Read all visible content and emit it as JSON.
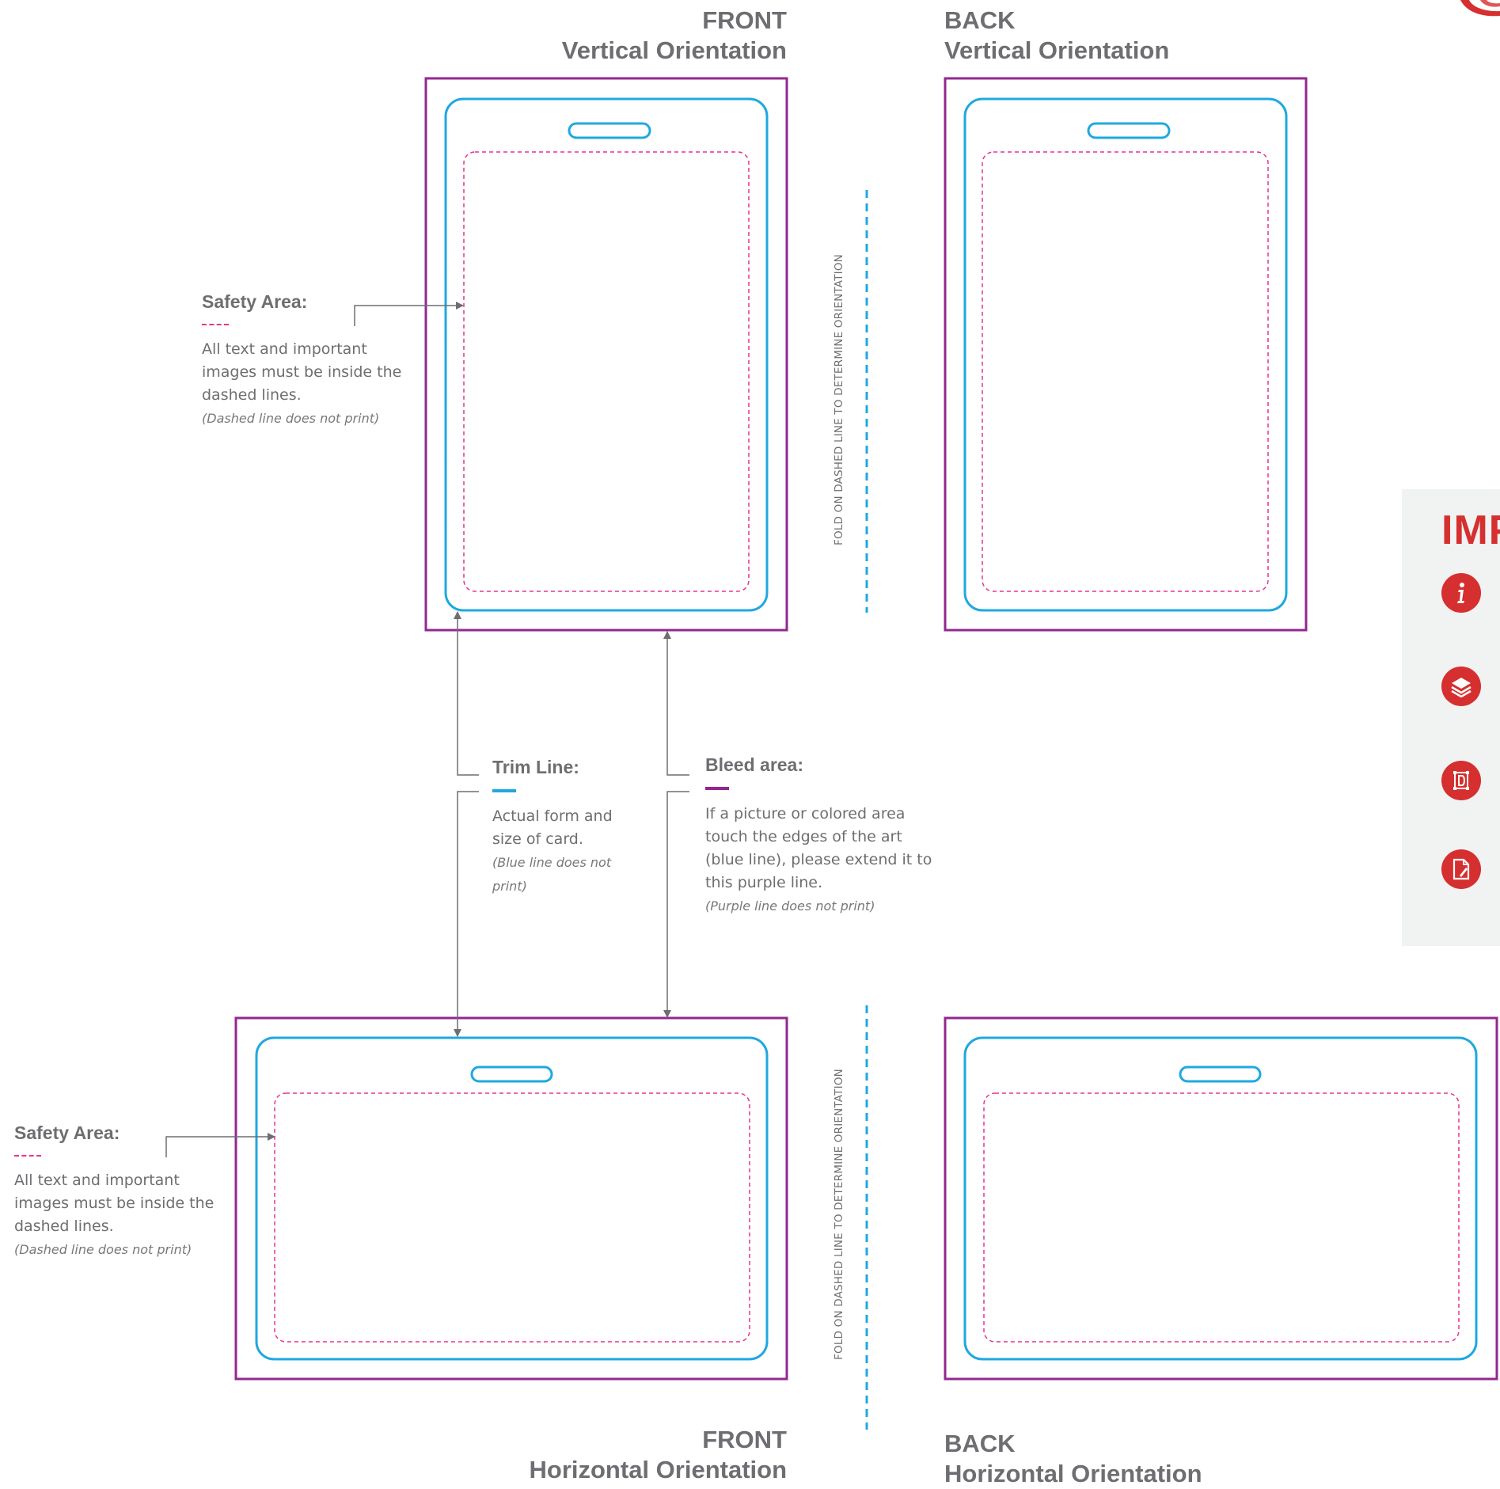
{
  "sections": {
    "front_vertical": {
      "line1": "FRONT",
      "line2": "Vertical Orientation"
    },
    "back_vertical": {
      "line1": "BACK",
      "line2": "Vertical Orientation"
    },
    "front_horizontal": {
      "line1": "FRONT",
      "line2": "Horizontal Orientation"
    },
    "back_horizontal": {
      "line1": "BACK",
      "line2": "Horizontal Orientation"
    }
  },
  "fold_label": "FOLD ON DASHED LINE TO DETERMINE ORIENTATION",
  "safety_area": {
    "title": "Safety Area:",
    "body_lines": [
      "All text and important",
      "images must be inside the",
      "dashed lines."
    ],
    "note": "(Dashed line does not print)"
  },
  "trim_line": {
    "title": "Trim Line:",
    "body_lines": [
      "Actual form and",
      "size of card."
    ],
    "note_lines": [
      "(Blue line does not",
      "print)"
    ]
  },
  "bleed_area": {
    "title": "Bleed area:",
    "body_lines": [
      "If a picture or colored area",
      "touch the edges of the art",
      "(blue line), please extend it to",
      "this purple line."
    ],
    "note": "(Purple line does not print)"
  },
  "important_panel": {
    "title": "IMP",
    "icons": [
      "info-icon",
      "layers-icon",
      "vector-pen-icon",
      "pdf-file-icon"
    ]
  },
  "colors": {
    "bleed": "#93278f",
    "trim": "#1fa8e0",
    "safety": "#e8338d",
    "text": "#6d6e71",
    "accent": "#d62f2f",
    "panel": "#f1f2f2"
  }
}
